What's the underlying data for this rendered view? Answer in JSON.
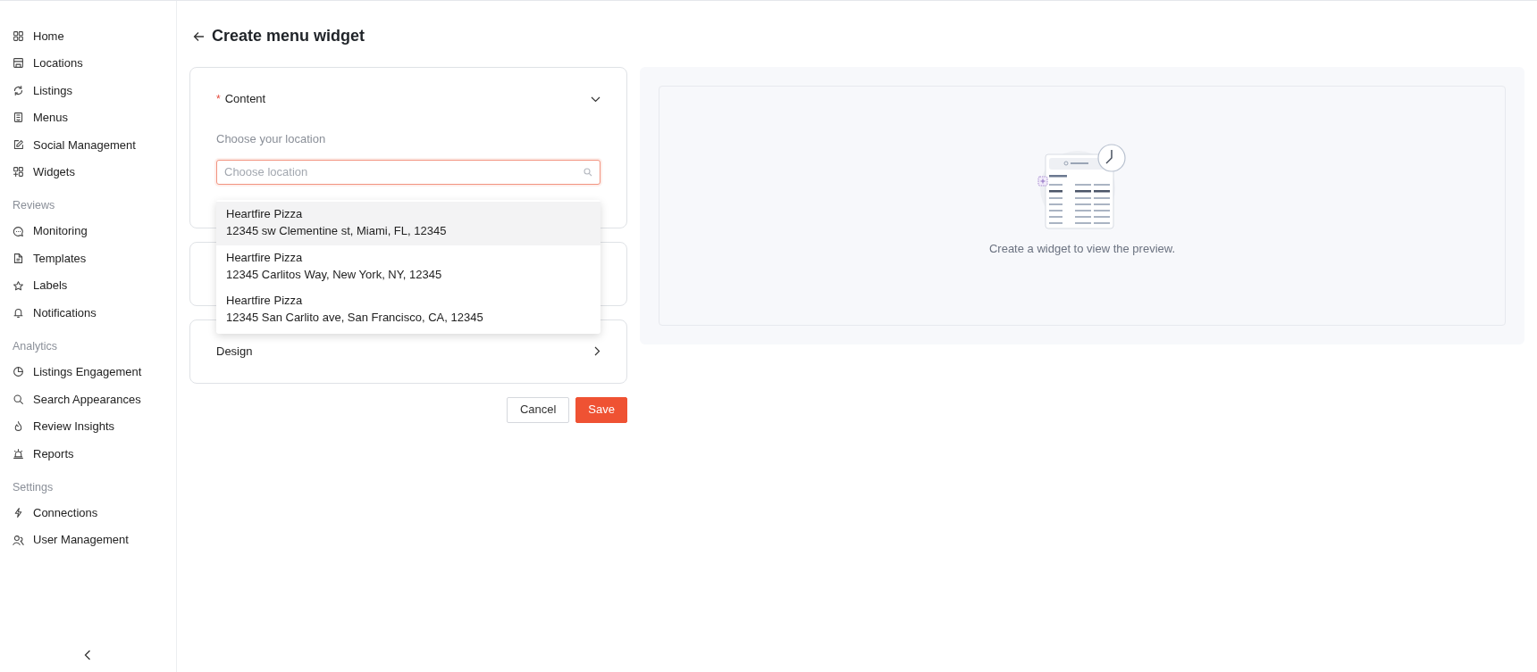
{
  "sidebar": {
    "groups": [
      {
        "items": [
          {
            "label": "Home"
          },
          {
            "label": "Locations"
          },
          {
            "label": "Listings"
          },
          {
            "label": "Menus"
          },
          {
            "label": "Social Management"
          },
          {
            "label": "Widgets"
          }
        ]
      },
      {
        "heading": "Reviews",
        "items": [
          {
            "label": "Monitoring"
          },
          {
            "label": "Templates"
          },
          {
            "label": "Labels"
          },
          {
            "label": "Notifications"
          }
        ]
      },
      {
        "heading": "Analytics",
        "items": [
          {
            "label": "Listings Engagement"
          },
          {
            "label": "Search Appearances"
          },
          {
            "label": "Review Insights"
          },
          {
            "label": "Reports"
          }
        ]
      },
      {
        "heading": "Settings",
        "items": [
          {
            "label": "Connections"
          },
          {
            "label": "User Management"
          }
        ]
      }
    ]
  },
  "page": {
    "title": "Create menu widget"
  },
  "sections": [
    {
      "kind": "panel",
      "required_mark": "*",
      "title": "Content",
      "expanded": true,
      "field_label": "Choose your location",
      "field": {
        "placeholder": "Choose location"
      },
      "options": [
        {
          "name": "Heartfire Pizza",
          "address": "12345 sw Clementine st, Miami, FL, 12345",
          "selected": true
        },
        {
          "name": "Heartfire Pizza",
          "address": "12345 Carlitos Way, New York, NY, 12345",
          "selected": false
        },
        {
          "name": "Heartfire Pizza",
          "address": "12345 San Carlito ave, San Francisco, CA, 12345",
          "selected": false
        }
      ]
    },
    {
      "kind": "covered"
    },
    {
      "kind": "panel",
      "title": "Design",
      "expanded": false
    }
  ],
  "buttons": [
    {
      "label": "Cancel",
      "kind": "secondary"
    },
    {
      "label": "Save",
      "kind": "primary"
    }
  ],
  "preview": {
    "message": "Create a widget to view the preview."
  }
}
